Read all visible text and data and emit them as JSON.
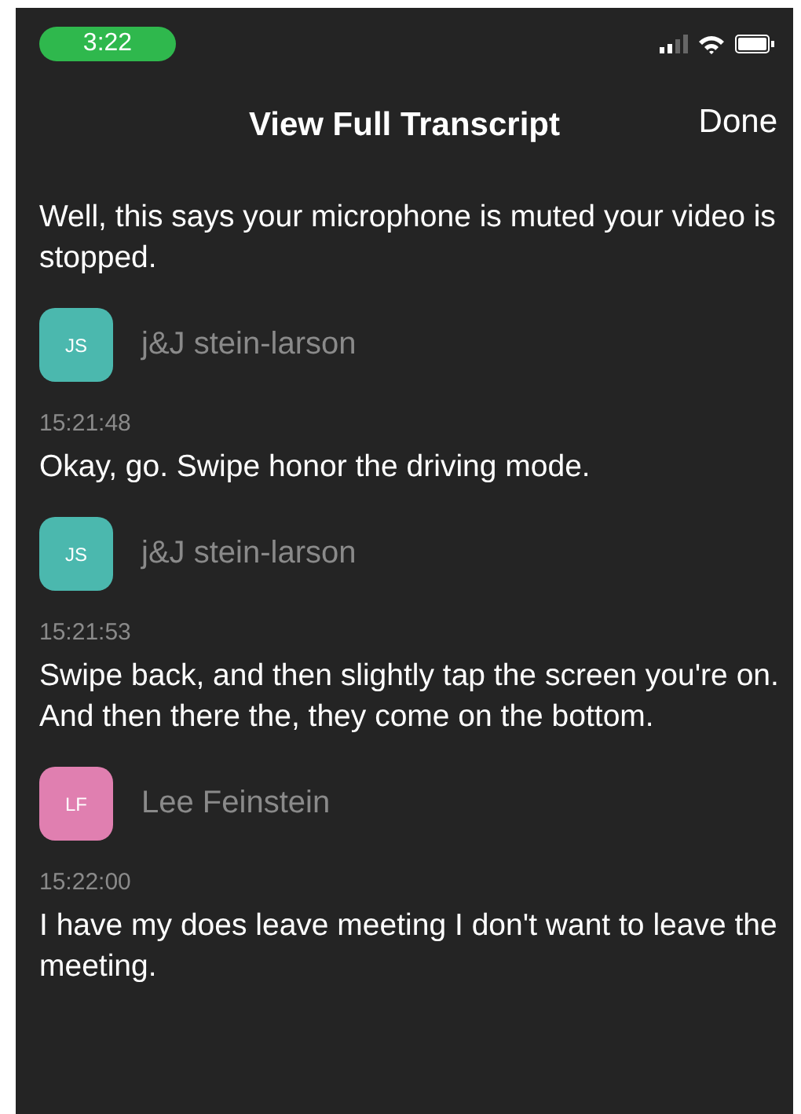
{
  "status_bar": {
    "time": "3:22"
  },
  "nav": {
    "title": "View Full Transcript",
    "done": "Done"
  },
  "entries": [
    {
      "text": "Well, this says your microphone is muted your video is stopped."
    },
    {
      "speaker": {
        "initials": "JS",
        "name": "j&J stein-larson",
        "color": "#4bb8ae"
      },
      "time": "15:21:48",
      "text": "Okay, go. Swipe honor the driving mode."
    },
    {
      "speaker": {
        "initials": "JS",
        "name": "j&J stein-larson",
        "color": "#4bb8ae"
      },
      "time": "15:21:53",
      "text": "Swipe back, and then slightly tap the screen you're on. And then there the, they come on the bottom."
    },
    {
      "speaker": {
        "initials": "LF",
        "name": "Lee Feinstein",
        "color": "#e07fb0"
      },
      "time": "15:22:00",
      "text": "I have my does leave meeting I don't want to leave the meeting."
    }
  ]
}
